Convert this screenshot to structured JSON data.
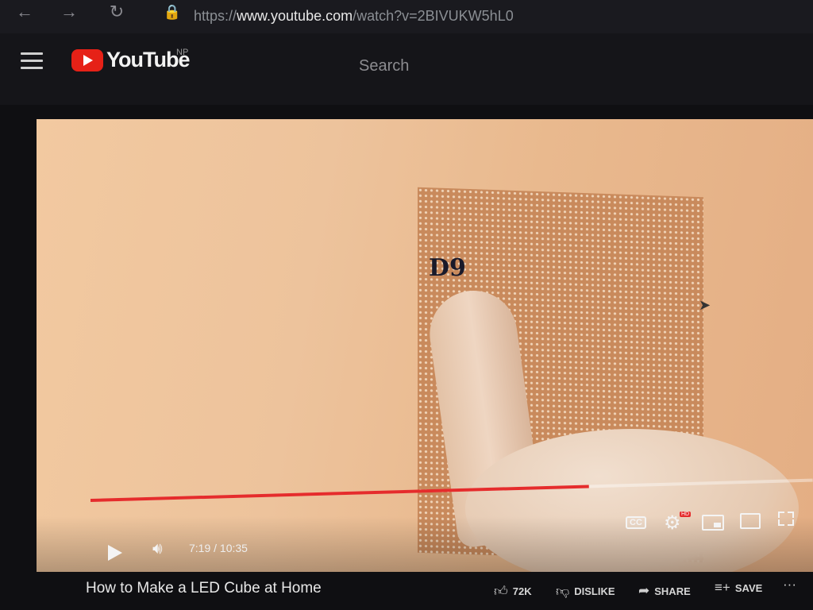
{
  "browser": {
    "url_prefix": "https://",
    "url_host": "www.youtube.com",
    "url_path": "/watch?v=2BIVUKW5hL0"
  },
  "header": {
    "logo_text": "YouTube",
    "country_code": "NP",
    "search_placeholder": "Search"
  },
  "player": {
    "overlay_label": "D9",
    "time_display": "7:19 / 10:35",
    "progress_fraction": 0.69,
    "cc_label": "CC",
    "hd_badge": "HD",
    "accent_color": "#e52c2c"
  },
  "video": {
    "title": "How to Make a LED Cube at Home",
    "likes": "72K",
    "dislike_label": "DISLIKE",
    "share_label": "SHARE",
    "save_label": "SAVE"
  }
}
